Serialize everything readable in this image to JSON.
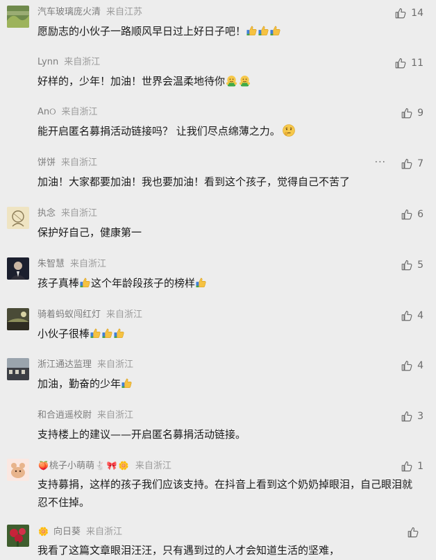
{
  "comments": [
    {
      "name": "汽车玻璃庞火清",
      "location": "来自江苏",
      "likes": "14",
      "text": "愿励志的小伙子一路顺风早日过上好日子吧！",
      "emoji": "thumbs-up x3"
    },
    {
      "name": "Lynn",
      "location": "来自浙江",
      "likes": "11",
      "text": "好样的，少年！加油！世界会温柔地待你",
      "emoji": "hug x2"
    },
    {
      "name": "An୦",
      "location": "来自浙江",
      "likes": "9",
      "text": "能开启匿名募捐活动链接吗？ 让我们尽点绵薄之力。",
      "emoji": "thinking"
    },
    {
      "name": "饼饼",
      "location": "来自浙江",
      "likes": "7",
      "text": "加油！大家都要加油！我也要加油！看到这个孩子，觉得自己不苦了",
      "more": "···"
    },
    {
      "name": "执念",
      "location": "来自浙江",
      "likes": "6",
      "text": "保护好自己，健康第一"
    },
    {
      "name": "朱智慧",
      "location": "来自浙江",
      "likes": "5",
      "text_a": "孩子真棒",
      "text_b": "这个年龄段孩子的榜样",
      "emoji": "thumbs-up"
    },
    {
      "name": "骑着蚂蚁闯红灯",
      "location": "来自浙江",
      "likes": "4",
      "text": "小伙子很棒",
      "emoji": "thumbs-up x3"
    },
    {
      "name": "浙江通达监理",
      "location": "来自浙江",
      "likes": "4",
      "text": "加油，勤奋的少年",
      "emoji": "thumbs-up"
    },
    {
      "name": "和合逍遥校尉",
      "location": "来自浙江",
      "likes": "3",
      "text": "支持楼上的建议——开启匿名募捐活动链接。"
    },
    {
      "name": "桃子小萌萌",
      "location": "来自浙江",
      "likes": "1",
      "text": "支持募捐，这样的孩子我们应该支持。在抖音上看到这个奶奶掉眼泪，自己眼泪就忍不住掉。",
      "name_emoji": "peach, bunny, ribbon, flower"
    },
    {
      "name": "向日葵",
      "location": "来自浙江",
      "likes": "",
      "text": "我看了这篇文章眼泪汪汪，只有遇到过的人才会知道生活的坚难，",
      "name_emoji": "flower"
    }
  ],
  "colors": {
    "background": "#ededed",
    "meta": "#7d7d7d",
    "text": "#1a1a1a",
    "like": "#6b6b6b"
  },
  "icons": {
    "like": "thumbs-up-outline-icon"
  }
}
